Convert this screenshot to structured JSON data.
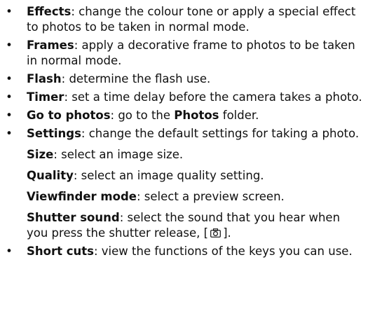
{
  "items": [
    {
      "term": "Effects",
      "text": ": change the colour tone or apply a special effect to photos to be taken in normal mode."
    },
    {
      "term": "Frames",
      "text": ": apply a decorative frame to photos to be taken in normal mode."
    },
    {
      "term": "Flash",
      "text": ": determine the flash use."
    },
    {
      "term": "Timer",
      "text": ": set a time delay before the camera takes a photo."
    },
    {
      "term": "Go to photos",
      "text_a": ": go to the ",
      "strong": "Photos",
      "text_b": " folder."
    },
    {
      "term": "Settings",
      "text": ": change the default settings for taking a photo."
    },
    {
      "term": "Short cuts",
      "text": ": view the functions of the keys you can use."
    }
  ],
  "settings_sub": [
    {
      "term": "Size",
      "text": ": select an image size."
    },
    {
      "term": "Quality",
      "text": ": select an image quality setting."
    },
    {
      "term": "Viewfinder mode",
      "text": ": select a preview screen."
    },
    {
      "term": "Shutter sound",
      "text": ": select the sound that you hear when you press the shutter release, [",
      "icon": "camera-icon",
      "text_end": "]."
    }
  ],
  "bullet_char": "•"
}
